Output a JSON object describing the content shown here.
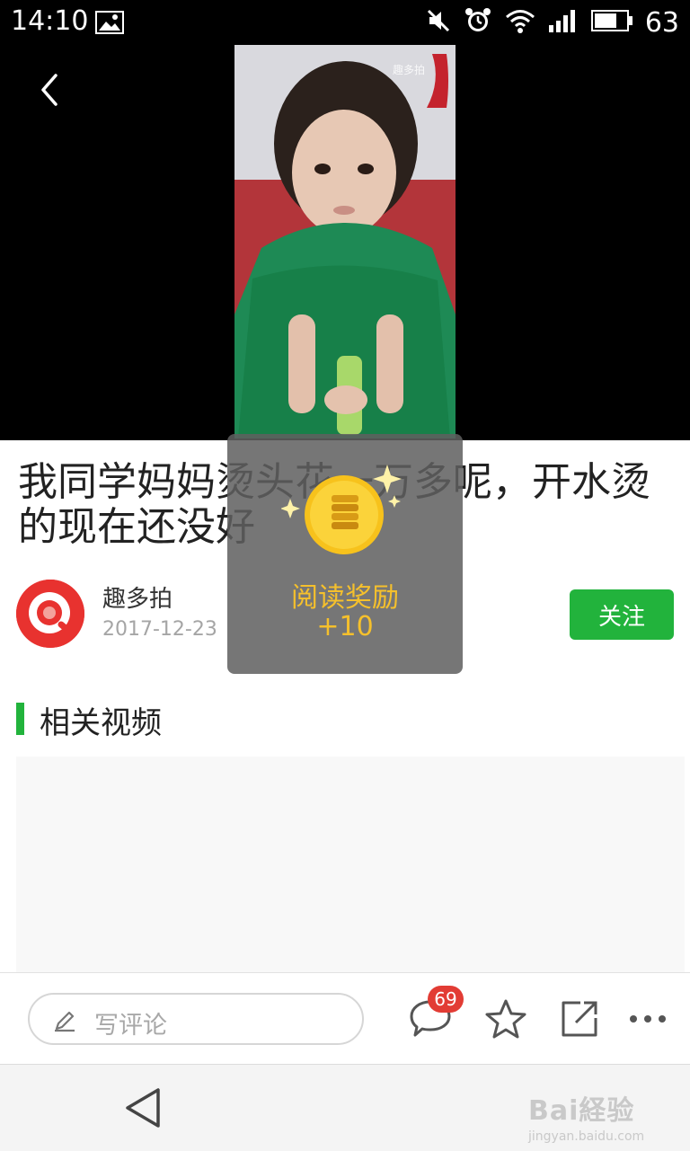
{
  "status_bar": {
    "time": "14:10",
    "battery": "63",
    "icons": [
      "image-icon",
      "mute-icon",
      "alarm-icon",
      "wifi-icon",
      "signal-icon",
      "battery-icon"
    ]
  },
  "video": {
    "watermark": "趣多拍"
  },
  "article": {
    "title": "我同学妈妈烫头花一万多呢，开水烫的现在还没好",
    "author": "趣多拍",
    "date": "2017-12-23",
    "follow_label": "关注"
  },
  "reward_popup": {
    "label": "阅读奖励",
    "value": "+10"
  },
  "related": {
    "section_title": "相关视频"
  },
  "action_bar": {
    "comment_placeholder": "写评论",
    "comment_count": "69"
  },
  "navbar": {
    "watermark_main": "Bai経验",
    "watermark_sub": "jingyan.baidu.com"
  },
  "colors": {
    "accent_green": "#22b33c",
    "badge_red": "#e23c34",
    "reward_gold": "#f5c02c",
    "avatar_red": "#e8322f"
  }
}
